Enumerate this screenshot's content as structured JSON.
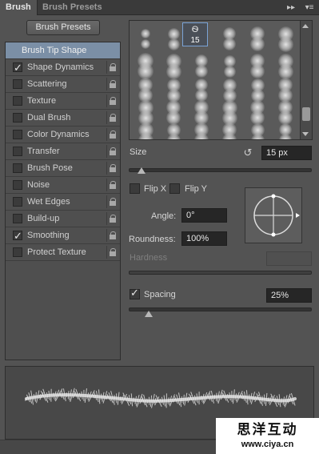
{
  "tabs": {
    "active": "Brush",
    "inactive": "Brush Presets"
  },
  "header_icons": {
    "collapse": "double-chevron-right-icon",
    "menu": "panel-menu-icon"
  },
  "presets_button": "Brush Presets",
  "brush_tip_shape": "Brush Tip Shape",
  "options": [
    {
      "label": "Shape Dynamics",
      "checked": true
    },
    {
      "label": "Scattering",
      "checked": false
    },
    {
      "label": "Texture",
      "checked": false
    },
    {
      "label": "Dual Brush",
      "checked": false
    },
    {
      "label": "Color Dynamics",
      "checked": false
    },
    {
      "label": "Transfer",
      "checked": false
    },
    {
      "label": "Brush Pose",
      "checked": false
    },
    {
      "label": "Noise",
      "checked": false
    },
    {
      "label": "Wet Edges",
      "checked": false
    },
    {
      "label": "Build-up",
      "checked": false
    },
    {
      "label": "Smoothing",
      "checked": true
    },
    {
      "label": "Protect Texture",
      "checked": false
    }
  ],
  "grid": {
    "selected_label": "15"
  },
  "size": {
    "label": "Size",
    "value": "15 px",
    "slider_fraction": 0.07
  },
  "flip": {
    "x_label": "Flip X",
    "y_label": "Flip Y",
    "x_checked": false,
    "y_checked": false
  },
  "angle": {
    "label": "Angle:",
    "value": "0°"
  },
  "roundness": {
    "label": "Roundness:",
    "value": "100%"
  },
  "hardness": {
    "label": "Hardness",
    "value": ""
  },
  "spacing": {
    "label": "Spacing",
    "checked": true,
    "value": "25%",
    "slider_fraction": 0.11
  },
  "watermark": {
    "main": "思洋互动",
    "sub": "www.ciya.cn"
  },
  "colors": {
    "panel": "#535353",
    "highlight": "#7b8fa6",
    "selection": "#7aa3d6"
  }
}
